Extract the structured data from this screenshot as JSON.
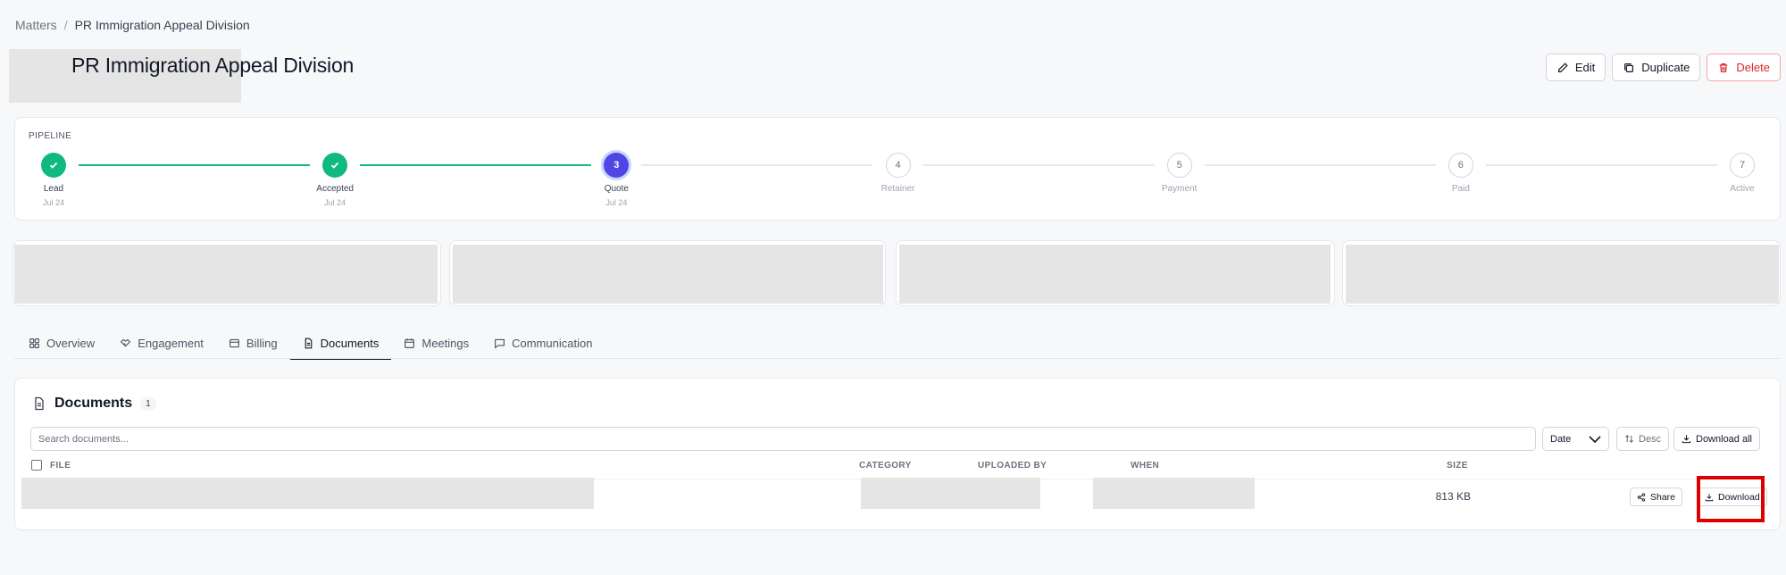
{
  "breadcrumb": {
    "root": "Matters",
    "separator": "/",
    "current": "PR Immigration Appeal Division"
  },
  "page": {
    "title": "PR Immigration Appeal Division"
  },
  "actions": {
    "edit": "Edit",
    "duplicate": "Duplicate",
    "delete": "Delete"
  },
  "pipeline": {
    "label": "PIPELINE",
    "steps": [
      {
        "number": "1",
        "label": "Lead",
        "date": "Jul 24",
        "status": "done"
      },
      {
        "number": "2",
        "label": "Accepted",
        "date": "Jul 24",
        "status": "done"
      },
      {
        "number": "3",
        "label": "Quote",
        "date": "Jul 24",
        "status": "current"
      },
      {
        "number": "4",
        "label": "Retainer",
        "date": "",
        "status": "todo"
      },
      {
        "number": "5",
        "label": "Payment",
        "date": "",
        "status": "todo"
      },
      {
        "number": "6",
        "label": "Paid",
        "date": "",
        "status": "todo"
      },
      {
        "number": "7",
        "label": "Active",
        "date": "",
        "status": "todo"
      }
    ]
  },
  "tabs": [
    {
      "label": "Overview",
      "icon": "grid-icon"
    },
    {
      "label": "Engagement",
      "icon": "handshake-icon"
    },
    {
      "label": "Billing",
      "icon": "wallet-icon"
    },
    {
      "label": "Documents",
      "icon": "document-icon",
      "active": true
    },
    {
      "label": "Meetings",
      "icon": "calendar-icon"
    },
    {
      "label": "Communication",
      "icon": "chat-icon"
    }
  ],
  "documents": {
    "title": "Documents",
    "count": "1",
    "search_placeholder": "Search documents...",
    "sort_value": "Date",
    "order_label": "Desc",
    "download_all": "Download all",
    "columns": {
      "file": "FILE",
      "category": "CATEGORY",
      "uploaded_by": "UPLOADED BY",
      "when": "WHEN",
      "size": "SIZE"
    },
    "rows": [
      {
        "size": "813 KB",
        "share": "Share",
        "download": "Download"
      }
    ]
  },
  "colors": {
    "accent": "#4f46e5",
    "success": "#10b981",
    "danger": "#dc2626",
    "highlight": "#dc0000"
  }
}
